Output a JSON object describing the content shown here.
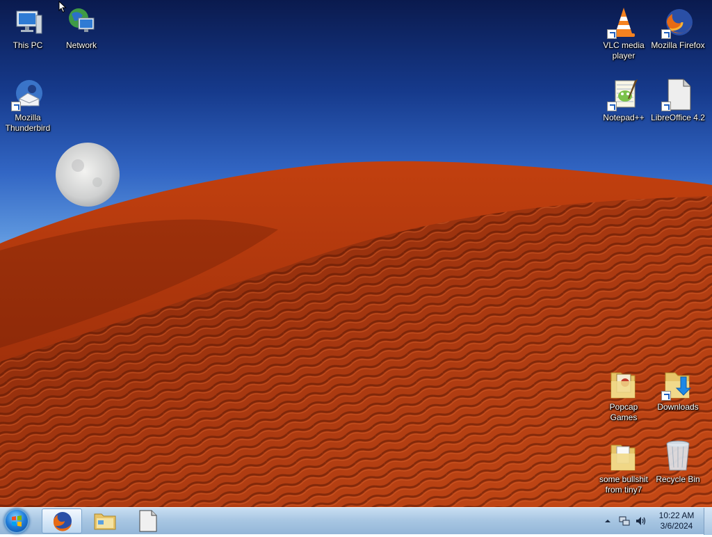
{
  "desktop": {
    "icons": {
      "this_pc": "This PC",
      "network": "Network",
      "thunderbird": "Mozilla Thunderbird",
      "vlc": "VLC media player",
      "firefox": "Mozilla Firefox",
      "notepadpp": "Notepad++",
      "libreoffice": "LibreOffice 4.2",
      "popcap": "Popcap Games",
      "downloads": "Downloads",
      "tiny7": "some bullshit from tiny7",
      "recycle_bin": "Recycle Bin"
    }
  },
  "taskbar": {
    "clock_time": "10:22 AM",
    "clock_date": "3/6/2024",
    "pinned": [
      "firefox-icon",
      "file-explorer-icon",
      "document-icon"
    ]
  },
  "colors": {
    "sky_top": "#0a1a4e",
    "sky_bottom": "#a9cdf3",
    "dune": "#b3390f",
    "taskbar": "#a9c7e3"
  }
}
